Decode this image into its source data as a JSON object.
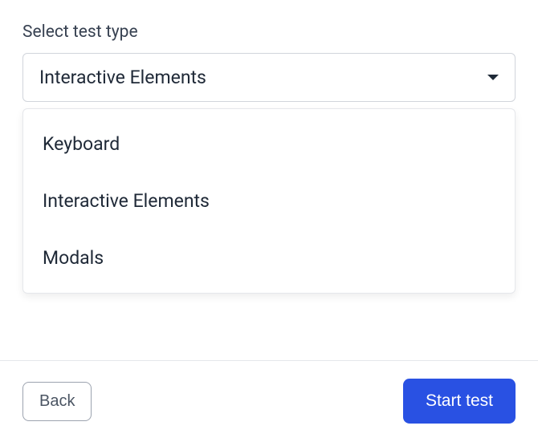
{
  "form": {
    "label": "Select test type",
    "selected": "Interactive Elements",
    "options": {
      "0": "Keyboard",
      "1": "Interactive Elements",
      "2": "Modals"
    }
  },
  "footer": {
    "back_label": "Back",
    "start_label": "Start test"
  }
}
